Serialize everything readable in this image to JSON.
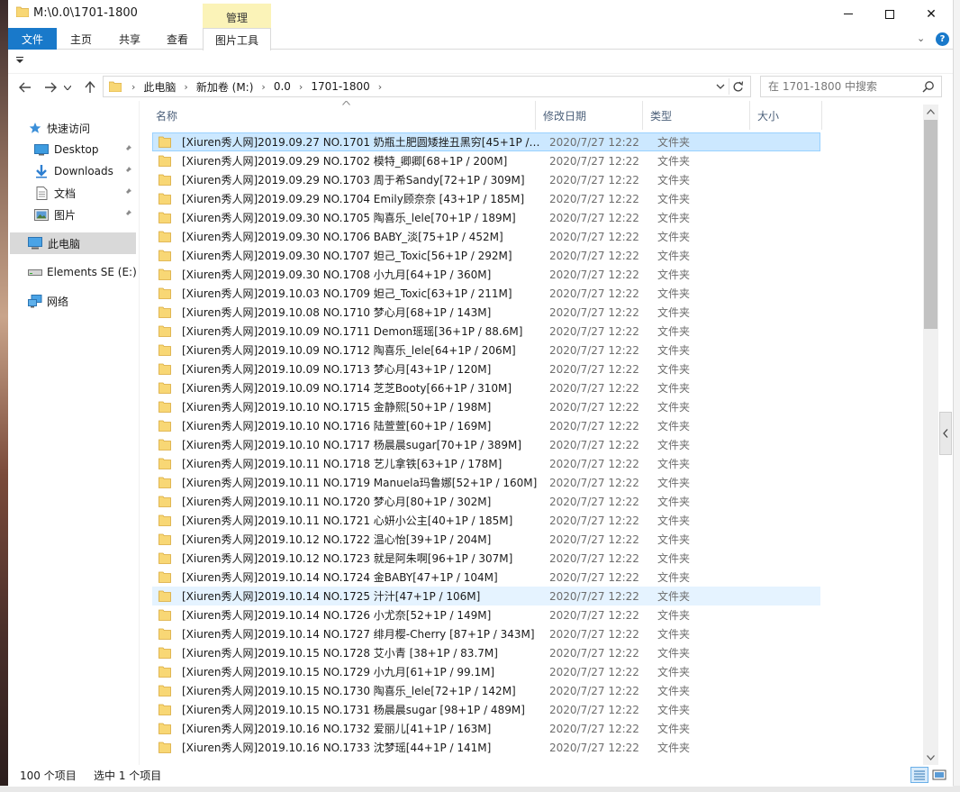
{
  "window": {
    "title": "M:\\0.0\\1701-1800",
    "minimize_icon": "minimize-icon",
    "maximize_icon": "maximize-icon",
    "close_label": "✕"
  },
  "ribbon": {
    "context_group": "管理",
    "tabs": [
      "文件",
      "主页",
      "共享",
      "查看",
      "图片工具"
    ],
    "collapse_label": "⌄",
    "help_label": "?"
  },
  "address": {
    "crumbs": [
      "此电脑",
      "新加卷 (M:)",
      "0.0",
      "1701-1800"
    ],
    "separator": "›"
  },
  "search": {
    "placeholder": "在 1701-1800 中搜索"
  },
  "navpane": {
    "items": [
      {
        "label": "快速访问",
        "icon": "star-icon",
        "pinned": false
      },
      {
        "label": "Desktop",
        "icon": "desktop-icon",
        "pinned": true
      },
      {
        "label": "Downloads",
        "icon": "download-arrow-icon",
        "pinned": true
      },
      {
        "label": "文档",
        "icon": "document-icon",
        "pinned": true
      },
      {
        "label": "图片",
        "icon": "picture-icon",
        "pinned": true
      },
      {
        "label": "此电脑",
        "icon": "computer-icon",
        "pinned": false
      },
      {
        "label": "Elements SE (E:)",
        "icon": "drive-icon",
        "pinned": false
      },
      {
        "label": "网络",
        "icon": "network-icon",
        "pinned": false
      }
    ],
    "pin_glyph": "📌"
  },
  "columns": {
    "name": "名称",
    "date": "修改日期",
    "type": "类型",
    "size": "大小"
  },
  "files": [
    {
      "name": "[Xiuren秀人网]2019.09.27 NO.1701 奶瓶土肥圆矮挫丑黑穷[45+1P / 2...",
      "date": "2020/7/27 12:22",
      "type": "文件夹",
      "state": "selected"
    },
    {
      "name": "[Xiuren秀人网]2019.09.29 NO.1702 模特_卿卿[68+1P / 200M]",
      "date": "2020/7/27 12:22",
      "type": "文件夹",
      "state": ""
    },
    {
      "name": "[Xiuren秀人网]2019.09.29 NO.1703 周于希Sandy[72+1P / 309M]",
      "date": "2020/7/27 12:22",
      "type": "文件夹",
      "state": ""
    },
    {
      "name": "[Xiuren秀人网]2019.09.29 NO.1704 Emily顾奈奈 [43+1P / 185M]",
      "date": "2020/7/27 12:22",
      "type": "文件夹",
      "state": ""
    },
    {
      "name": "[Xiuren秀人网]2019.09.30 NO.1705 陶喜乐_lele[70+1P / 189M]",
      "date": "2020/7/27 12:22",
      "type": "文件夹",
      "state": ""
    },
    {
      "name": "[Xiuren秀人网]2019.09.30 NO.1706 BABY_淡[75+1P / 452M]",
      "date": "2020/7/27 12:22",
      "type": "文件夹",
      "state": ""
    },
    {
      "name": "[Xiuren秀人网]2019.09.30 NO.1707 妲己_Toxic[56+1P / 292M]",
      "date": "2020/7/27 12:22",
      "type": "文件夹",
      "state": ""
    },
    {
      "name": "[Xiuren秀人网]2019.09.30 NO.1708 小九月[64+1P / 360M]",
      "date": "2020/7/27 12:22",
      "type": "文件夹",
      "state": ""
    },
    {
      "name": "[Xiuren秀人网]2019.10.03 NO.1709 妲己_Toxic[63+1P / 211M]",
      "date": "2020/7/27 12:22",
      "type": "文件夹",
      "state": ""
    },
    {
      "name": "[Xiuren秀人网]2019.10.08 NO.1710 梦心月[68+1P / 143M]",
      "date": "2020/7/27 12:22",
      "type": "文件夹",
      "state": ""
    },
    {
      "name": "[Xiuren秀人网]2019.10.09 NO.1711 Demon瑶瑶[36+1P / 88.6M]",
      "date": "2020/7/27 12:22",
      "type": "文件夹",
      "state": ""
    },
    {
      "name": "[Xiuren秀人网]2019.10.09 NO.1712 陶喜乐_lele[64+1P / 206M]",
      "date": "2020/7/27 12:22",
      "type": "文件夹",
      "state": ""
    },
    {
      "name": "[Xiuren秀人网]2019.10.09 NO.1713 梦心月[43+1P / 120M]",
      "date": "2020/7/27 12:22",
      "type": "文件夹",
      "state": ""
    },
    {
      "name": "[Xiuren秀人网]2019.10.09 NO.1714 芝芝Booty[66+1P / 310M]",
      "date": "2020/7/27 12:22",
      "type": "文件夹",
      "state": ""
    },
    {
      "name": "[Xiuren秀人网]2019.10.10 NO.1715 金静熙[50+1P / 198M]",
      "date": "2020/7/27 12:22",
      "type": "文件夹",
      "state": ""
    },
    {
      "name": "[Xiuren秀人网]2019.10.10 NO.1716 陆萱萱[60+1P / 169M]",
      "date": "2020/7/27 12:22",
      "type": "文件夹",
      "state": ""
    },
    {
      "name": "[Xiuren秀人网]2019.10.10 NO.1717 杨晨晨sugar[70+1P / 389M]",
      "date": "2020/7/27 12:22",
      "type": "文件夹",
      "state": ""
    },
    {
      "name": "[Xiuren秀人网]2019.10.11 NO.1718 艺儿拿铁[63+1P / 178M]",
      "date": "2020/7/27 12:22",
      "type": "文件夹",
      "state": ""
    },
    {
      "name": "[Xiuren秀人网]2019.10.11 NO.1719 Manuela玛鲁娜[52+1P / 160M]",
      "date": "2020/7/27 12:22",
      "type": "文件夹",
      "state": ""
    },
    {
      "name": "[Xiuren秀人网]2019.10.11 NO.1720 梦心月[80+1P / 302M]",
      "date": "2020/7/27 12:22",
      "type": "文件夹",
      "state": ""
    },
    {
      "name": "[Xiuren秀人网]2019.10.11 NO.1721 心妍小公主[40+1P / 185M]",
      "date": "2020/7/27 12:22",
      "type": "文件夹",
      "state": ""
    },
    {
      "name": "[Xiuren秀人网]2019.10.12 NO.1722 温心怡[39+1P / 204M]",
      "date": "2020/7/27 12:22",
      "type": "文件夹",
      "state": ""
    },
    {
      "name": "[Xiuren秀人网]2019.10.12 NO.1723 就是阿朱啊[96+1P / 307M]",
      "date": "2020/7/27 12:22",
      "type": "文件夹",
      "state": ""
    },
    {
      "name": "[Xiuren秀人网]2019.10.14 NO.1724 金BABY[47+1P / 104M]",
      "date": "2020/7/27 12:22",
      "type": "文件夹",
      "state": ""
    },
    {
      "name": "[Xiuren秀人网]2019.10.14 NO.1725 汁汁[47+1P / 106M]",
      "date": "2020/7/27 12:22",
      "type": "文件夹",
      "state": "hover"
    },
    {
      "name": "[Xiuren秀人网]2019.10.14 NO.1726 小尤奈[52+1P / 149M]",
      "date": "2020/7/27 12:22",
      "type": "文件夹",
      "state": ""
    },
    {
      "name": "[Xiuren秀人网]2019.10.14 NO.1727 绯月樱-Cherry [87+1P / 343M]",
      "date": "2020/7/27 12:22",
      "type": "文件夹",
      "state": ""
    },
    {
      "name": "[Xiuren秀人网]2019.10.15 NO.1728 艾小青 [38+1P / 83.7M]",
      "date": "2020/7/27 12:22",
      "type": "文件夹",
      "state": ""
    },
    {
      "name": "[Xiuren秀人网]2019.10.15 NO.1729 小九月[61+1P / 99.1M]",
      "date": "2020/7/27 12:22",
      "type": "文件夹",
      "state": ""
    },
    {
      "name": "[Xiuren秀人网]2019.10.15 NO.1730 陶喜乐_lele[72+1P / 142M]",
      "date": "2020/7/27 12:22",
      "type": "文件夹",
      "state": ""
    },
    {
      "name": "[Xiuren秀人网]2019.10.15 NO.1731 杨晨晨sugar [98+1P / 489M]",
      "date": "2020/7/27 12:22",
      "type": "文件夹",
      "state": ""
    },
    {
      "name": "[Xiuren秀人网]2019.10.16 NO.1732 爱丽儿[41+1P / 163M]",
      "date": "2020/7/27 12:22",
      "type": "文件夹",
      "state": ""
    },
    {
      "name": "[Xiuren秀人网]2019.10.16 NO.1733 沈梦瑶[44+1P / 141M]",
      "date": "2020/7/27 12:22",
      "type": "文件夹",
      "state": ""
    }
  ],
  "status": {
    "item_count": "100 个项目",
    "selected": "选中 1 个项目"
  },
  "colors": {
    "accent": "#1979ca",
    "selection": "#cce8ff",
    "hover": "#e5f3ff",
    "folder": "#f8d775"
  }
}
